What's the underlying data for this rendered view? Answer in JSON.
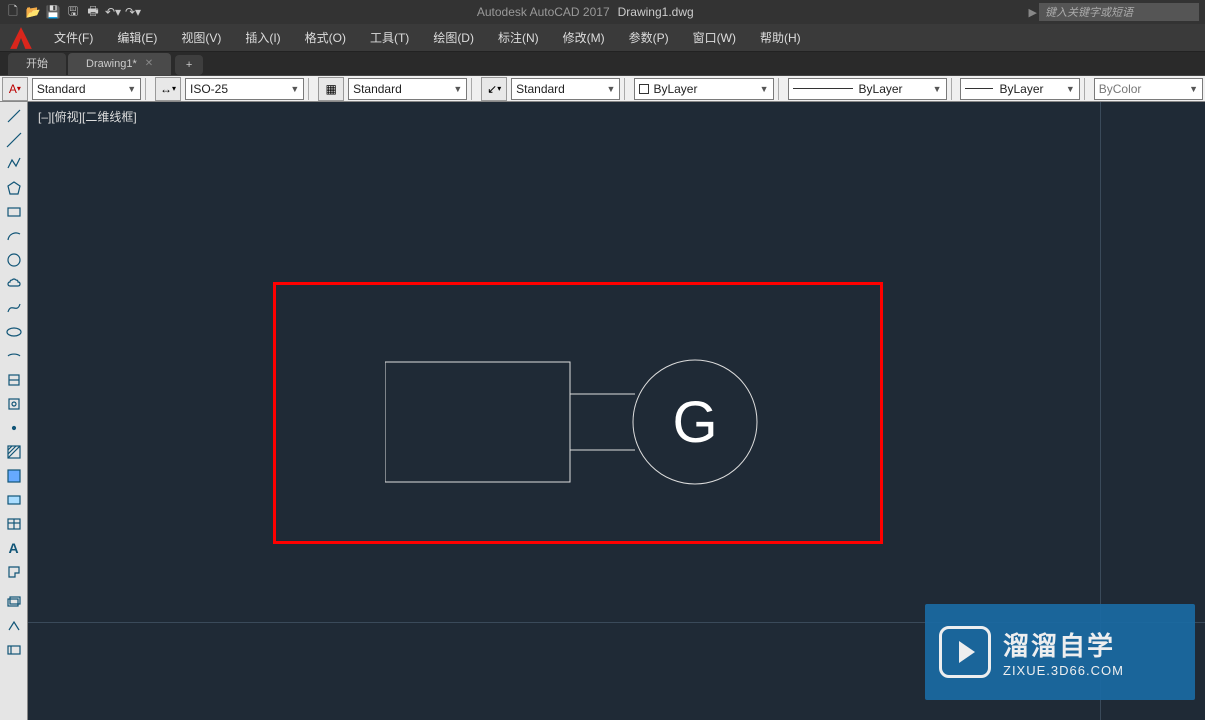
{
  "app": {
    "name": "Autodesk AutoCAD 2017",
    "file": "Drawing1.dwg",
    "search_placeholder": "键入关键字或短语"
  },
  "menu": {
    "file": "文件(F)",
    "edit": "编辑(E)",
    "view": "视图(V)",
    "insert": "插入(I)",
    "format": "格式(O)",
    "tools": "工具(T)",
    "draw": "绘图(D)",
    "dimension": "标注(N)",
    "modify": "修改(M)",
    "parametric": "参数(P)",
    "window": "窗口(W)",
    "help": "帮助(H)"
  },
  "tabs": {
    "start": "开始",
    "drawing": "Drawing1*",
    "new": "+"
  },
  "ribbon": {
    "textstyle": "Standard",
    "dimstyle": "ISO-25",
    "tablestyle": "Standard",
    "mleader": "Standard",
    "layer": "ByLayer",
    "linetype": "ByLayer",
    "lineweight": "ByLayer",
    "color": "ByColor"
  },
  "viewport": {
    "label": "[–][俯视][二维线框]"
  },
  "drawing_content": {
    "text_in_circle": "G"
  },
  "watermark": {
    "title": "溜溜自学",
    "url": "ZIXUE.3D66.COM"
  }
}
